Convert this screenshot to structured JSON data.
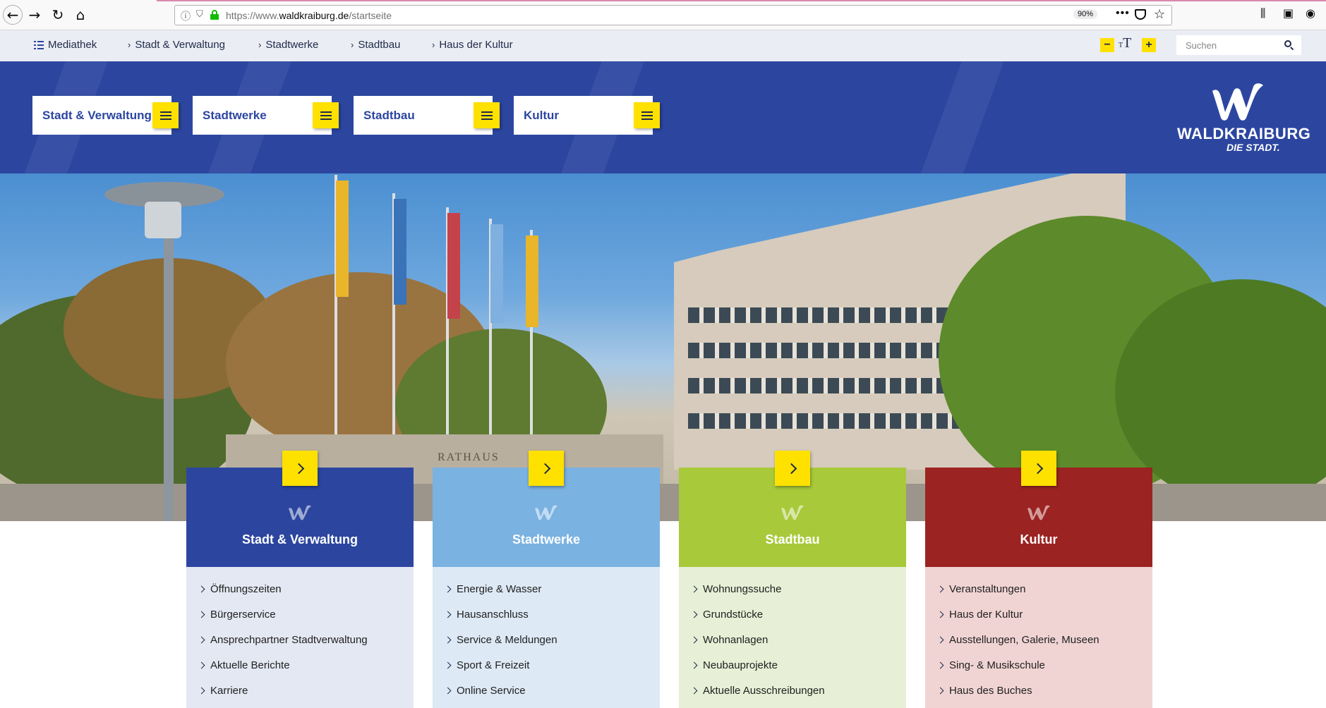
{
  "browser": {
    "url_prefix": "https://www.",
    "url_host": "waldkraiburg.de",
    "url_path": "/startseite",
    "zoom": "90%"
  },
  "utility_nav": {
    "items": [
      {
        "label": "Mediathek"
      },
      {
        "label": "Stadt & Verwaltung"
      },
      {
        "label": "Stadtwerke"
      },
      {
        "label": "Stadtbau"
      },
      {
        "label": "Haus der Kultur"
      }
    ],
    "font_minus": "−",
    "font_plus": "+",
    "font_small": "T",
    "font_big": "T",
    "search_placeholder": "Suchen"
  },
  "header": {
    "menus": [
      {
        "label": "Stadt & Verwaltung"
      },
      {
        "label": "Stadtwerke"
      },
      {
        "label": "Stadtbau"
      },
      {
        "label": "Kultur"
      }
    ],
    "logo_line1": "WALDKRAIBURG",
    "logo_line2": "DIE STADT."
  },
  "hero": {
    "sign_text": "RATHAUS"
  },
  "colors": {
    "brand_blue": "#2c46a0",
    "accent_yellow": "#ffe100",
    "stadtwerke_blue": "#7ab2e2",
    "stadtbau_green": "#a8c93a",
    "kultur_red": "#9b2321"
  },
  "cards": [
    {
      "title": "Stadt & Verwaltung",
      "head_color": "#2c46a0",
      "body_color": "#e4e8f3",
      "links": [
        "Öffnungszeiten",
        "Bürgerservice",
        "Ansprechpartner Stadtverwaltung",
        "Aktuelle Berichte",
        "Karriere"
      ]
    },
    {
      "title": "Stadtwerke",
      "head_color": "#7ab2e2",
      "body_color": "#dde9f5",
      "links": [
        "Energie & Wasser",
        "Hausanschluss",
        "Service & Meldungen",
        "Sport & Freizeit",
        "Online Service"
      ]
    },
    {
      "title": "Stadtbau",
      "head_color": "#a8c93a",
      "body_color": "#e7efd6",
      "links": [
        "Wohnungssuche",
        "Grundstücke",
        "Wohnanlagen",
        "Neubauprojekte",
        "Aktuelle Ausschreibungen"
      ]
    },
    {
      "title": "Kultur",
      "head_color": "#9b2321",
      "body_color": "#f0d4d3",
      "links": [
        "Veranstaltungen",
        "Haus der Kultur",
        "Ausstellungen, Galerie, Museen",
        "Sing- & Musikschule",
        "Haus des Buches"
      ]
    }
  ]
}
